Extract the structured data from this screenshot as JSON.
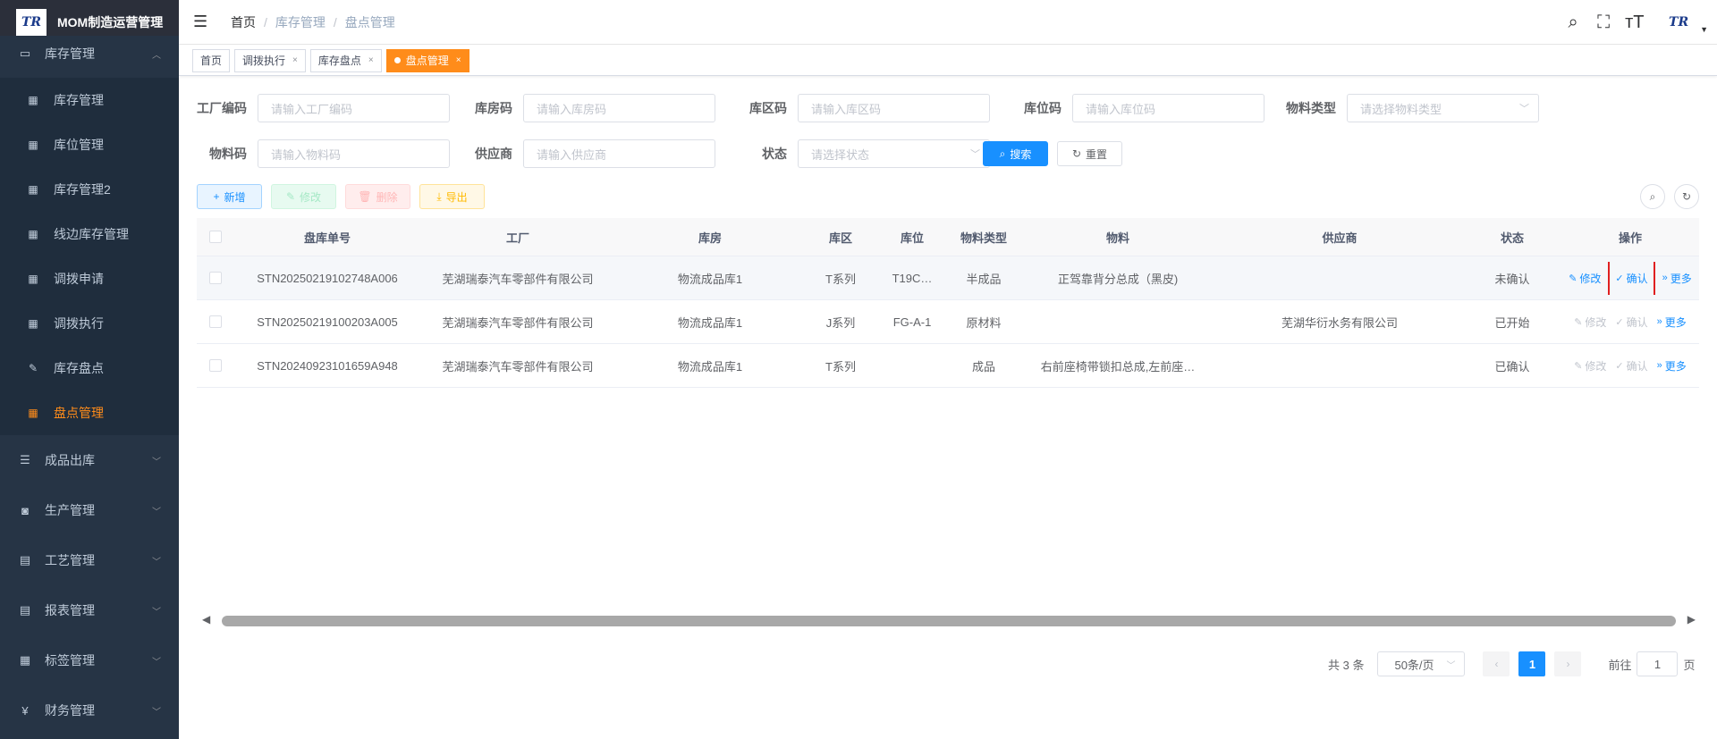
{
  "app": {
    "title": "MOM制造运营管理",
    "logo_text": "TR"
  },
  "sidebar": {
    "top_section": {
      "label": "库存管理",
      "icon": "monitor-icon"
    },
    "sub_items": [
      {
        "label": "库存管理"
      },
      {
        "label": "库位管理"
      },
      {
        "label": "库存管理2"
      },
      {
        "label": "线边库存管理"
      },
      {
        "label": "调拨申请"
      },
      {
        "label": "调拨执行"
      },
      {
        "label": "库存盘点"
      },
      {
        "label": "盘点管理"
      }
    ],
    "sections": [
      {
        "label": "成品出库"
      },
      {
        "label": "生产管理"
      },
      {
        "label": "工艺管理"
      },
      {
        "label": "报表管理"
      },
      {
        "label": "标签管理"
      },
      {
        "label": "财务管理"
      }
    ]
  },
  "header": {
    "breadcrumb": [
      "首页",
      "库存管理",
      "盘点管理"
    ],
    "avatar_text": "TR"
  },
  "tags": [
    {
      "label": "首页"
    },
    {
      "label": "调拨执行"
    },
    {
      "label": "库存盘点"
    },
    {
      "label": "盘点管理"
    }
  ],
  "filters": {
    "factory_code": {
      "label": "工厂编码",
      "placeholder": "请输入工厂编码"
    },
    "warehouse_code": {
      "label": "库房码",
      "placeholder": "请输入库房码"
    },
    "area_code": {
      "label": "库区码",
      "placeholder": "请输入库区码"
    },
    "location_code": {
      "label": "库位码",
      "placeholder": "请输入库位码"
    },
    "material_type": {
      "label": "物料类型",
      "placeholder": "请选择物料类型"
    },
    "material_code": {
      "label": "物料码",
      "placeholder": "请输入物料码"
    },
    "supplier": {
      "label": "供应商",
      "placeholder": "请输入供应商"
    },
    "status": {
      "label": "状态",
      "placeholder": "请选择状态"
    },
    "search_label": "搜索",
    "reset_label": "重置"
  },
  "toolbar": {
    "add_label": "新增",
    "edit_label": "修改",
    "delete_label": "删除",
    "export_label": "导出"
  },
  "table": {
    "headers": [
      "盘库单号",
      "工厂",
      "库房",
      "库区",
      "库位",
      "物料类型",
      "物料",
      "供应商",
      "状态",
      "操作"
    ],
    "rows": [
      {
        "no": "STN20250219102748A006",
        "factory": "芜湖瑞泰汽车零部件有限公司",
        "warehouse": "物流成品库1",
        "area": "T系列",
        "location": "T19C…",
        "mtype": "半成品",
        "material": "正驾靠背分总成（黑皮)",
        "supplier": "",
        "status": "未确认"
      },
      {
        "no": "STN20250219100203A005",
        "factory": "芜湖瑞泰汽车零部件有限公司",
        "warehouse": "物流成品库1",
        "area": "J系列",
        "location": "FG-A-1",
        "mtype": "原材料",
        "material": "",
        "supplier": "芜湖华衍水务有限公司",
        "status": "已开始"
      },
      {
        "no": "STN20240923101659A948",
        "factory": "芜湖瑞泰汽车零部件有限公司",
        "warehouse": "物流成品库1",
        "area": "T系列",
        "location": "",
        "mtype": "成品",
        "material": "右前座椅带锁扣总成,左前座…",
        "supplier": "",
        "status": "已确认"
      }
    ],
    "op_edit": "修改",
    "op_confirm": "确认",
    "op_more": "更多"
  },
  "pagination": {
    "total_text": "共 3 条",
    "page_size": "50条/页",
    "current_page": "1",
    "goto_label": "前往",
    "goto_value": "1",
    "page_suffix": "页"
  }
}
